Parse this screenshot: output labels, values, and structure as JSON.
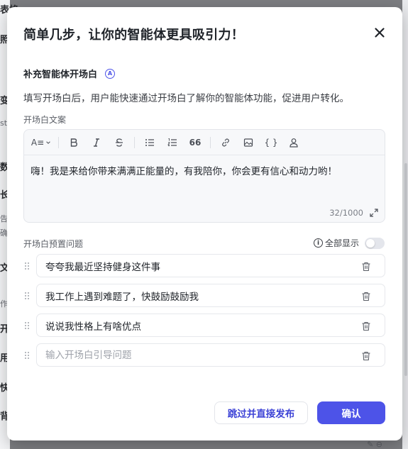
{
  "background": {
    "fragments": [
      "表格",
      "照",
      "变",
      "stu",
      "数",
      "长",
      "告",
      "确",
      "文",
      "作",
      "开",
      "用",
      "快",
      "背"
    ]
  },
  "modal": {
    "title": "简单几步，让你的智能体更具吸引力！",
    "section_title": "补充智能体开场白",
    "ai_badge": "A",
    "description": "填写开场白后，用户能快速通过开场白了解你的智能体功能，促进用户转化。",
    "editor": {
      "label": "开场白文案",
      "font_size_label": "A≡",
      "quote_label": "66",
      "code_label": "{ }",
      "content": "嗨！我是来给你带来满满正能量的，有我陪你，你会更有信心和动力哟！",
      "counter": "32/1000"
    },
    "preset": {
      "label": "开场白预置问题",
      "show_all_label": "全部显示",
      "show_all_enabled": false,
      "questions": [
        {
          "value": "夸夸我最近坚持健身这件事",
          "placeholder": ""
        },
        {
          "value": "我工作上遇到难题了，快鼓励鼓励我",
          "placeholder": ""
        },
        {
          "value": "说说我性格上有啥优点",
          "placeholder": ""
        },
        {
          "value": "",
          "placeholder": "输入开场白引导问题"
        }
      ]
    },
    "buttons": {
      "skip": "跳过并直接发布",
      "confirm": "确认"
    }
  },
  "colors": {
    "accent": "#4d53e8",
    "overlay": "#7d7e82"
  }
}
